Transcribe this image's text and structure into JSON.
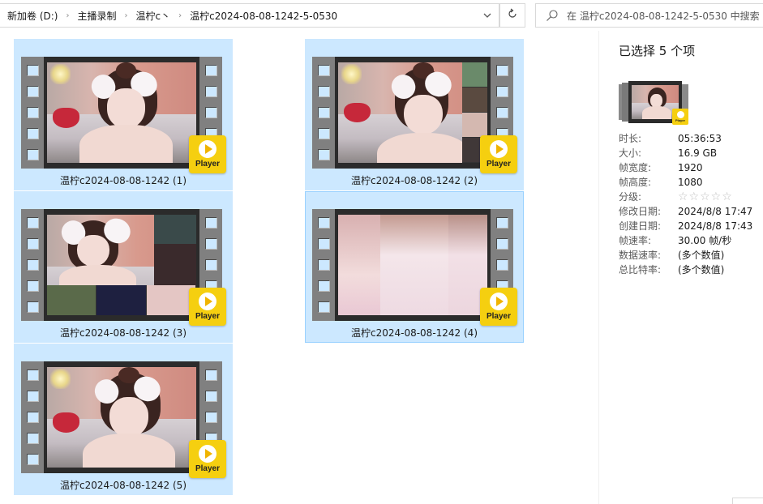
{
  "address_bar": {
    "breadcrumbs": [
      "新加卷 (D:)",
      "主播录制",
      "温柠c丶",
      "温柠c2024-08-08-1242-5-0530"
    ],
    "separator_icon": "chevron-right-icon",
    "dropdown_icon": "chevron-down-icon",
    "refresh_icon": "refresh-icon"
  },
  "search": {
    "placeholder": "在 温柠c2024-08-08-1242-5-0530 中搜索",
    "icon": "search-icon"
  },
  "files": [
    {
      "name": "温柠c2024-08-08-1242 (1)",
      "badge": "Player",
      "selected": true
    },
    {
      "name": "温柠c2024-08-08-1242 (2)",
      "badge": "Player",
      "selected": true
    },
    {
      "name": "温柠c2024-08-08-1242 (3)",
      "badge": "Player",
      "selected": true
    },
    {
      "name": "温柠c2024-08-08-1242 (4)",
      "badge": "Player",
      "selected": true,
      "focused": true
    },
    {
      "name": "温柠c2024-08-08-1242 (5)",
      "badge": "Player",
      "selected": true
    }
  ],
  "details": {
    "title": "已选择 5 个项",
    "thumb_badge": "Player",
    "properties": [
      {
        "key": "时长:",
        "value": "05:36:53"
      },
      {
        "key": "大小:",
        "value": "16.9 GB"
      },
      {
        "key": "帧宽度:",
        "value": "1920"
      },
      {
        "key": "帧高度:",
        "value": "1080"
      },
      {
        "key": "分级:",
        "value": "☆☆☆☆☆",
        "rating": 0,
        "rating_max": 5
      },
      {
        "key": "修改日期:",
        "value": "2024/8/8 17:47"
      },
      {
        "key": "创建日期:",
        "value": "2024/8/8 17:43"
      },
      {
        "key": "帧速率:",
        "value": "30.00 帧/秒"
      },
      {
        "key": "数据速率:",
        "value": "(多个数值)"
      },
      {
        "key": "总比特率:",
        "value": "(多个数值)"
      }
    ]
  },
  "colors": {
    "selection": "#cce8ff",
    "selection_border": "#99d1ff",
    "player_badge": "#f5cf10"
  }
}
